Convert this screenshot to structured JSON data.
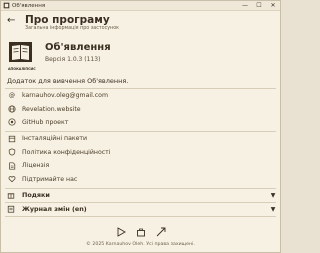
{
  "window": {
    "title": "Об'явлення"
  },
  "header": {
    "title": "Про програму",
    "subtitle": "Загальна інформація про застосунок"
  },
  "app": {
    "name": "Об'явлення",
    "version": "Версія 1.0.3 (113)",
    "logo_caption": "АПОКАЛІПСИС"
  },
  "description": "Додаток для вивчення Об'явлення.",
  "links": [
    {
      "label": "karnauhov.oleg@gmail.com",
      "icon": "at-icon"
    },
    {
      "label": "Revelation.website",
      "icon": "globe-icon"
    },
    {
      "label": "GitHub проект",
      "icon": "github-icon"
    }
  ],
  "info_items": [
    {
      "label": "Інсталяційні пакети",
      "icon": "package-icon"
    },
    {
      "label": "Політика конфіденційності",
      "icon": "shield-icon"
    },
    {
      "label": "Ліцензія",
      "icon": "document-icon"
    },
    {
      "label": "Підтримайте нас",
      "icon": "heart-icon"
    }
  ],
  "sections": [
    {
      "label": "Подяки",
      "icon": "gift-icon"
    },
    {
      "label": "Журнал змін (en)",
      "icon": "changelog-icon"
    }
  ],
  "footer": "© 2025 Karnauhov Oleh. Усі права захищені.",
  "colors": {
    "background": "#f7f1e3",
    "text": "#3a2f20",
    "divider": "#d8ceb8"
  }
}
